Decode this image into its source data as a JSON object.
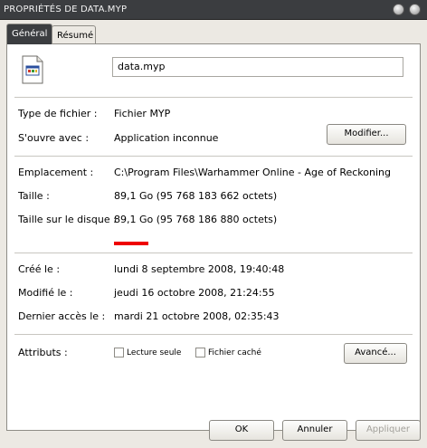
{
  "window": {
    "title": "PROPRIÉTÉS DE DATA.MYP"
  },
  "tabs": [
    {
      "label": "Général",
      "active": true
    },
    {
      "label": "Résumé",
      "active": false
    }
  ],
  "file": {
    "name": "data.myp",
    "icon": "generic-file-icon"
  },
  "fields": {
    "type_label": "Type de fichier :",
    "type_value": "Fichier MYP",
    "opens_label": "S'ouvre avec :",
    "opens_value": "Application inconnue",
    "modify_button": "Modifier...",
    "location_label": "Emplacement :",
    "location_value": "C:\\Program Files\\Warhammer Online - Age of Reckoning",
    "size_label": "Taille :",
    "size_value": "89,1 Go (95 768 183 662 octets)",
    "disk_size_label": "Taille sur le disque :",
    "disk_size_value": "89,1 Go (95 768 186 880 octets)",
    "created_label": "Créé le :",
    "created_value": "lundi 8 septembre 2008, 19:40:48",
    "modified_label": "Modifié le :",
    "modified_value": "jeudi 16 octobre 2008, 21:24:55",
    "accessed_label": "Dernier accès le :",
    "accessed_value": "mardi 21 octobre 2008, 02:35:43"
  },
  "attributes": {
    "label": "Attributs :",
    "readonly_label": "Lecture seule",
    "readonly_checked": false,
    "hidden_label": "Fichier caché",
    "hidden_checked": false,
    "advanced_button": "Avancé..."
  },
  "buttons": {
    "ok": "OK",
    "cancel": "Annuler",
    "apply": "Appliquer"
  },
  "colors": {
    "titlebar": "#3b3d40",
    "highlight": "#ee0000",
    "background": "#ece9e3"
  }
}
